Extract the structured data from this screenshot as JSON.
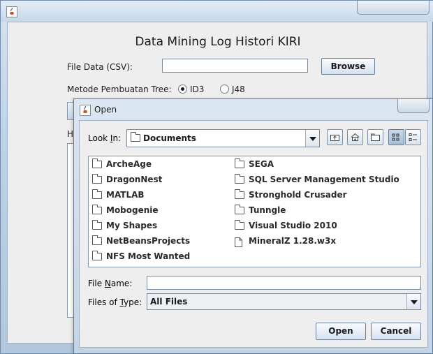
{
  "main_window": {
    "title": "Data Mining Log Histori KIRI",
    "file_data_label": "File Data (CSV):",
    "file_data_value": "",
    "browse_label": "Browse",
    "metode_label": "Metode Pembuatan Tree:",
    "radio_options": [
      {
        "label": "ID3",
        "selected": true
      },
      {
        "label": "J48",
        "selected": false
      }
    ],
    "hasil_label_fragment": "Ha"
  },
  "open_dialog": {
    "title": "Open",
    "look_in_label_prefix": "Look ",
    "look_in_label_mnemonic": "I",
    "look_in_label_suffix": "n:",
    "look_in_value": "Documents",
    "files": [
      {
        "name": "ArcheAge",
        "type": "folder"
      },
      {
        "name": "DragonNest",
        "type": "folder"
      },
      {
        "name": "MATLAB",
        "type": "folder"
      },
      {
        "name": "Mobogenie",
        "type": "folder"
      },
      {
        "name": "My Shapes",
        "type": "folder"
      },
      {
        "name": "NetBeansProjects",
        "type": "folder"
      },
      {
        "name": "NFS Most Wanted",
        "type": "folder"
      },
      {
        "name": "SEGA",
        "type": "folder"
      },
      {
        "name": "SQL Server Management Studio",
        "type": "folder"
      },
      {
        "name": "Stronghold Crusader",
        "type": "folder"
      },
      {
        "name": "Tunngle",
        "type": "folder"
      },
      {
        "name": "Visual Studio 2010",
        "type": "folder"
      },
      {
        "name": "MineralZ 1.28.w3x",
        "type": "file"
      }
    ],
    "file_name_label_prefix": "File ",
    "file_name_label_mnemonic": "N",
    "file_name_label_suffix": "ame:",
    "file_name_value": "",
    "files_of_type_label_prefix": "Files of ",
    "files_of_type_label_mnemonic": "T",
    "files_of_type_label_suffix": "ype:",
    "files_of_type_value": "All Files",
    "open_label": "Open",
    "cancel_label": "Cancel"
  }
}
